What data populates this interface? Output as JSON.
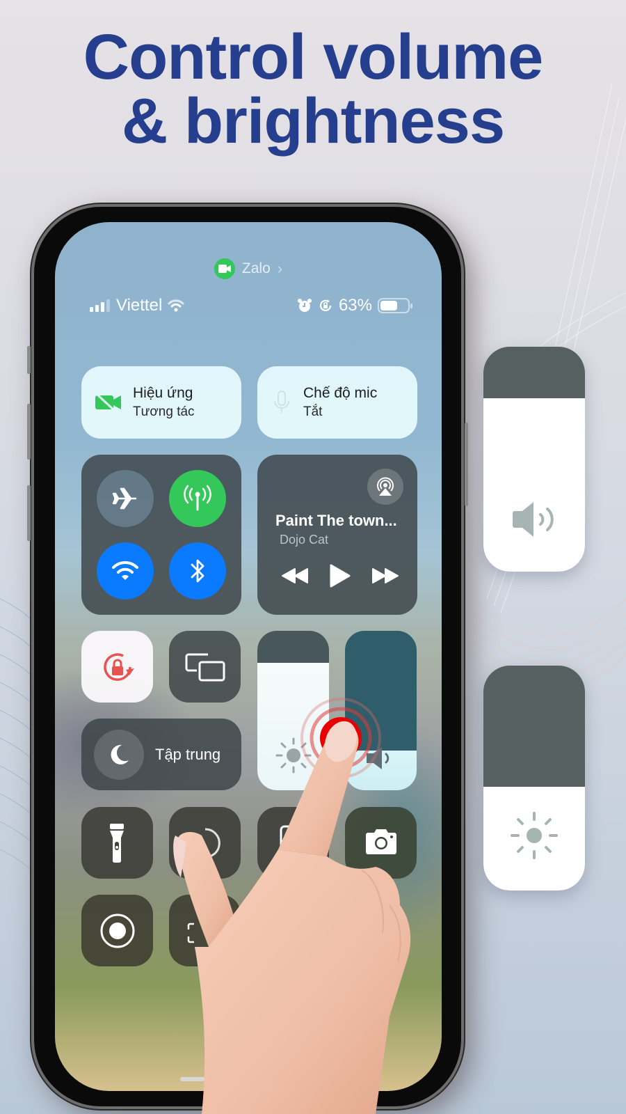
{
  "headline": {
    "line1": "Control volume",
    "line2": "& brightness"
  },
  "colors": {
    "headline": "#253f8e",
    "green": "#34c759",
    "blue": "#0a7aff",
    "rotation_lock_red": "#e8524f",
    "touch_red": "#e80000"
  },
  "screen": {
    "active_app": {
      "icon": "video-camera-icon",
      "label": "Zalo",
      "chevron": "›"
    },
    "status_bar": {
      "carrier": "Viettel",
      "signal_icon": "signal-bars-icon",
      "wifi_icon": "wifi-icon",
      "alarm_icon": "alarm-clock-icon",
      "orientation_lock_icon": "orientation-lock-icon",
      "battery_percent": "63%",
      "battery_level": 0.63
    },
    "video_effects": {
      "title": "Hiệu ứng",
      "subtitle": "Tương tác",
      "icon": "video-off-icon"
    },
    "mic_mode": {
      "title": "Chế độ mic",
      "subtitle": "Tắt",
      "icon": "mic-icon"
    },
    "connectivity": {
      "airplane": {
        "icon": "airplane-icon",
        "on": false
      },
      "cellular": {
        "icon": "cellular-antenna-icon",
        "on": true
      },
      "wifi": {
        "icon": "wifi-icon",
        "on": true
      },
      "bluetooth": {
        "icon": "bluetooth-icon",
        "on": true
      }
    },
    "now_playing": {
      "title": "Paint The town...",
      "artist": "Dojo Cat",
      "airplay_icon": "airplay-audio-icon",
      "controls": [
        "rewind-icon",
        "play-icon",
        "fast-forward-icon"
      ]
    },
    "rotation_lock": {
      "icon": "rotation-lock-icon",
      "on": true
    },
    "screen_mirroring": {
      "icon": "screen-mirroring-icon"
    },
    "focus": {
      "label": "Tập trung",
      "icon": "moon-icon"
    },
    "brightness_slider": {
      "icon": "sun-icon",
      "level": 0.8
    },
    "volume_slider": {
      "icon": "speaker-icon",
      "level": 0.25
    },
    "bottom_tiles": [
      {
        "name": "flashlight",
        "icon": "flashlight-icon"
      },
      {
        "name": "timer",
        "icon": "timer-icon"
      },
      {
        "name": "calculator",
        "icon": "calculator-icon"
      },
      {
        "name": "camera",
        "icon": "camera-icon"
      },
      {
        "name": "screen-record",
        "icon": "record-icon"
      },
      {
        "name": "qr-scanner",
        "icon": "qr-code-icon"
      }
    ]
  },
  "floating_volume": {
    "icon": "speaker-icon",
    "level": 0.77
  },
  "floating_brightness": {
    "icon": "sun-icon",
    "level": 0.46
  }
}
